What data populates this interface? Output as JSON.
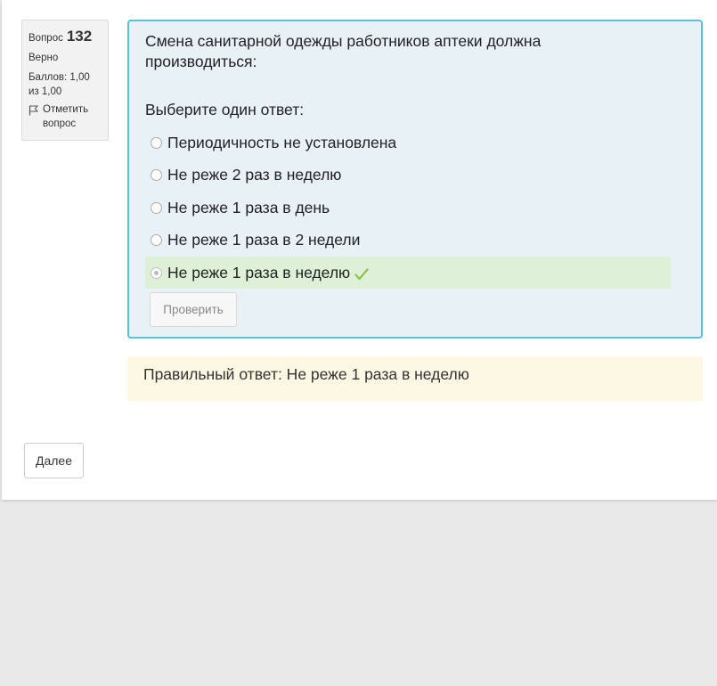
{
  "question_info": {
    "label": "Вопрос",
    "number": "132",
    "state": "Верно",
    "grade": "Баллов: 1,00 из 1,00",
    "flag_label": "Отметить вопрос",
    "flag_icon": "flag-icon"
  },
  "question": {
    "text": "Смена санитарной одежды работников аптеки должна производиться:",
    "prompt": "Выберите один ответ:",
    "answers": [
      {
        "label": "Периодичность не установлена",
        "selected": false,
        "correct": false
      },
      {
        "label": "Не реже 2 раз в неделю",
        "selected": false,
        "correct": false
      },
      {
        "label": "Не реже 1 раза в день",
        "selected": false,
        "correct": false
      },
      {
        "label": "Не реже 1 раза в 2 недели",
        "selected": false,
        "correct": false
      },
      {
        "label": "Не реже 1 раза в неделю",
        "selected": true,
        "correct": true
      }
    ],
    "check_button": "Проверить"
  },
  "feedback": {
    "right_answer": "Правильный ответ: Не реже 1 раза в неделю"
  },
  "navigation": {
    "next_button": "Далее"
  },
  "colors": {
    "question_border": "#5bc0de",
    "question_bg": "#e8f1f6",
    "correct_bg": "#dff0d8",
    "feedback_bg": "#fcf8e3",
    "check_mark": "#8bc34a"
  }
}
